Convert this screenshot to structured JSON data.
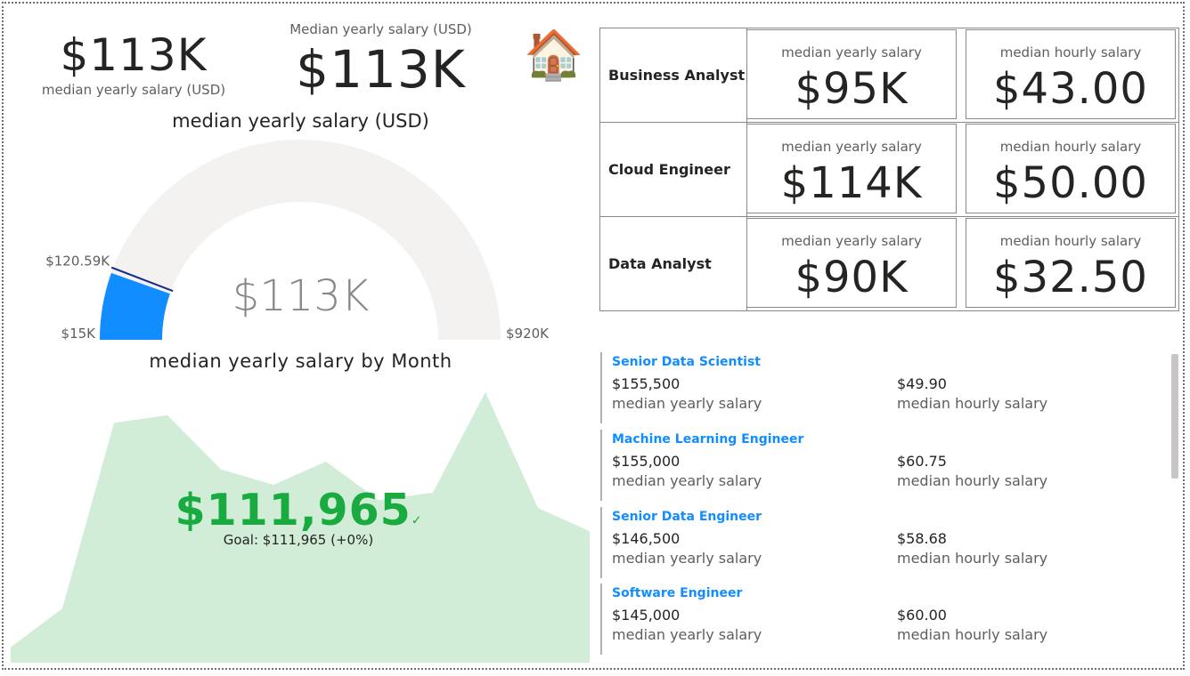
{
  "card_small": {
    "value": "$113K",
    "label": "median yearly salary (USD)"
  },
  "card_large": {
    "label": "Median yearly salary (USD)",
    "value": "$113K"
  },
  "icon": {
    "name": "house-icon",
    "glyph": "🏠"
  },
  "gauge": {
    "title": "median yearly salary (USD)",
    "min_label": "$15K",
    "max_label": "$920K",
    "target_label": "$120.59K",
    "center_label": "$113K",
    "min": 15000,
    "max": 920000,
    "value": 113000,
    "target": 120590,
    "fill_color": "#118dff",
    "track_color": "#f3f2f1",
    "target_color": "#1b2a8a"
  },
  "kpi": {
    "title": "median yearly salary by Month",
    "value": "$111,965",
    "check": "✓",
    "goal": "Goal: $111,965 (+0%)",
    "color": "#1aab40",
    "area_color": "#d1edd7",
    "trend": [
      10,
      35,
      155,
      160,
      125,
      115,
      130,
      105,
      110,
      175,
      100,
      85
    ]
  },
  "matrix": {
    "rows": [
      {
        "name": "Business Analyst",
        "yearly_label": "median yearly salary",
        "yearly": "$95K",
        "hourly_label": "median hourly salary",
        "hourly": "$43.00"
      },
      {
        "name": "Cloud Engineer",
        "yearly_label": "median yearly salary",
        "yearly": "$114K",
        "hourly_label": "median hourly salary",
        "hourly": "$50.00"
      },
      {
        "name": "Data Analyst",
        "yearly_label": "median yearly salary",
        "yearly": "$90K",
        "hourly_label": "median hourly salary",
        "hourly": "$32.50"
      }
    ]
  },
  "multirow": {
    "items": [
      {
        "title": "Senior Data Scientist",
        "yearly": "$155,500",
        "yearly_label": "median yearly salary",
        "hourly": "$49.90",
        "hourly_label": "median hourly salary"
      },
      {
        "title": "Machine Learning Engineer",
        "yearly": "$155,000",
        "yearly_label": "median yearly salary",
        "hourly": "$60.75",
        "hourly_label": "median hourly salary"
      },
      {
        "title": "Senior Data Engineer",
        "yearly": "$146,500",
        "yearly_label": "median yearly salary",
        "hourly": "$58.68",
        "hourly_label": "median hourly salary"
      },
      {
        "title": "Software Engineer",
        "yearly": "$145,000",
        "yearly_label": "median yearly salary",
        "hourly": "$60.00",
        "hourly_label": "median hourly salary"
      }
    ]
  }
}
